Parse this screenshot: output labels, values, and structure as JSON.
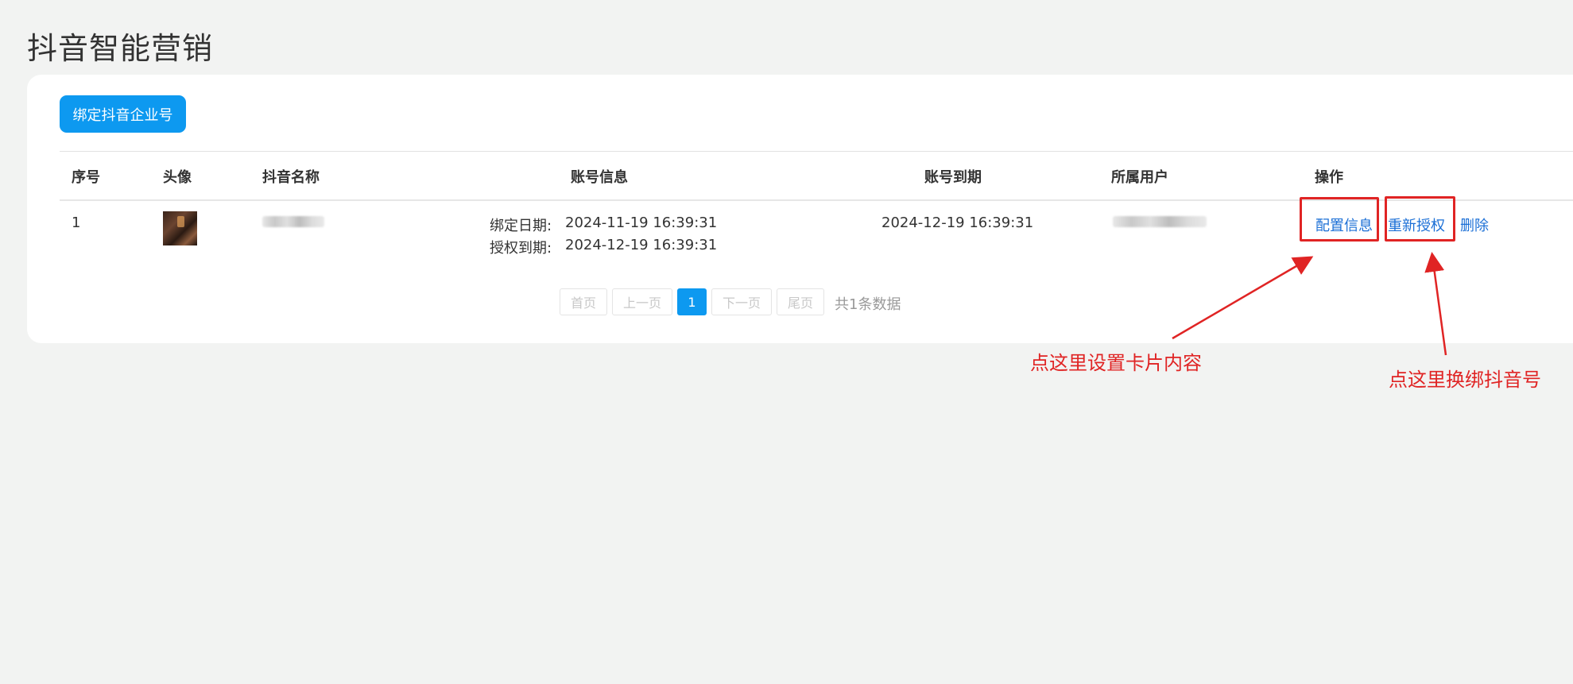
{
  "page": {
    "title": "抖音智能营销"
  },
  "toolbar": {
    "bind_button": "绑定抖音企业号"
  },
  "table": {
    "headers": {
      "index": "序号",
      "avatar": "头像",
      "name": "抖音名称",
      "account_info": "账号信息",
      "expire": "账号到期",
      "owner": "所属用户",
      "actions": "操作"
    },
    "rows": [
      {
        "index": "1",
        "bind_date_label": "绑定日期:",
        "bind_date": "2024-11-19 16:39:31",
        "auth_date_label": "授权到期:",
        "auth_date": "2024-12-19 16:39:31",
        "expire": "2024-12-19 16:39:31",
        "actions": {
          "config": "配置信息",
          "reauth": "重新授权",
          "delete": "删除"
        }
      }
    ]
  },
  "pagination": {
    "first": "首页",
    "prev": "上一页",
    "current": "1",
    "next": "下一页",
    "last": "尾页",
    "total": "共1条数据"
  },
  "annotations": {
    "config_hint": "点这里设置卡片内容",
    "reauth_hint": "点这里换绑抖音号"
  },
  "colors": {
    "accent": "#0d99f0",
    "link": "#1b6fd6",
    "annotation": "#e02424",
    "background": "#f2f3f2"
  }
}
